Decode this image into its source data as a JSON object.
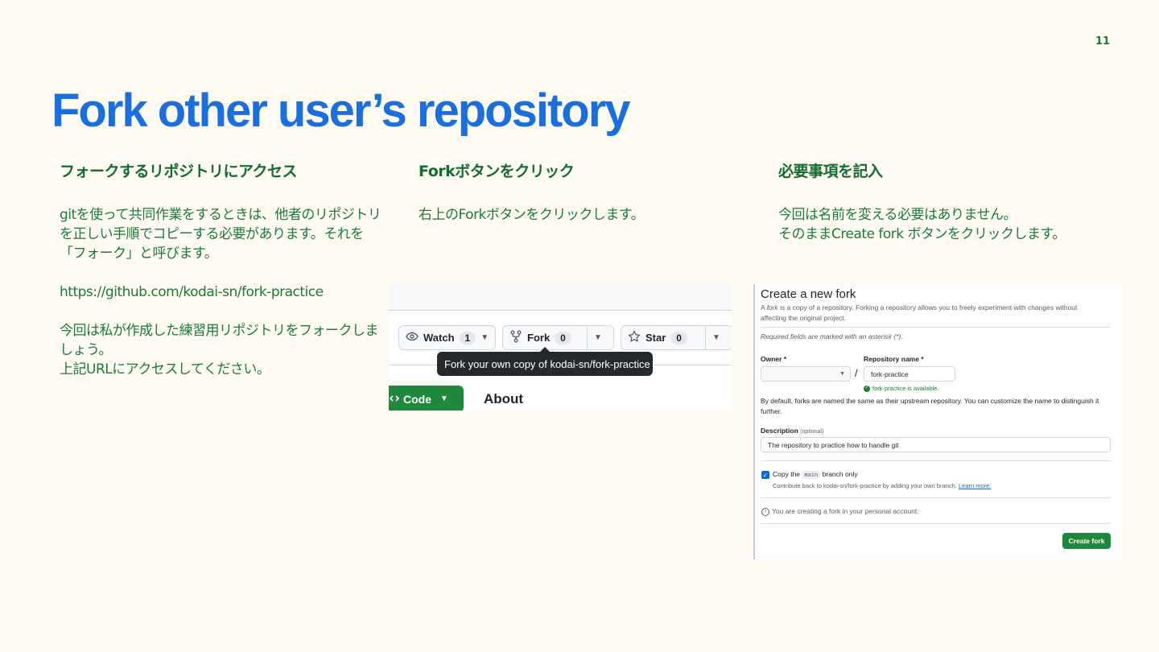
{
  "page_number": "11",
  "title": "Fork other user’s repository",
  "columns": [
    {
      "heading": "フォークするリポジトリにアクセス",
      "paragraphs": [
        "gitを使って共同作業をするときは、他者のリポジトリを正しい手順でコピーする必要があります。それを「フォーク」と呼びます。",
        "https://github.com/kodai-sn/fork-practice",
        "今回は私が作成した練習用リポジトリをフォークしましょう。",
        "上記URLにアクセスしてください。"
      ]
    },
    {
      "heading": "Forkボタンをクリック",
      "paragraphs": [
        "右上のForkボタンをクリックします。"
      ]
    },
    {
      "heading": "必要事項を記入",
      "paragraphs": [
        "今回は名前を変える必要はありません。",
        "そのままCreate fork ボタンをクリックします。"
      ]
    }
  ],
  "github_toolbar": {
    "watch_label": "Watch",
    "watch_count": "1",
    "fork_label": "Fork",
    "fork_count": "0",
    "star_label": "Star",
    "star_count": "0",
    "tooltip": "Fork your own copy of kodai-sn/fork-practice",
    "code_label": "Code",
    "about_label": "About"
  },
  "fork_form": {
    "heading": "Create a new fork",
    "intro_prefix": "A ",
    "intro_italic": "fork",
    "intro_rest": " is a copy of a repository. Forking a repository allows you to freely experiment with changes without affecting the original project.",
    "required_note": "Required fields are marked with an asterisk (*).",
    "owner_label": "Owner *",
    "owner_value": "",
    "repo_name_label": "Repository name *",
    "repo_name_value": "fork-practice",
    "availability": "fork-practice is available.",
    "slash": "/",
    "naming_note": "By default, forks are named the same as their upstream repository. You can customize the name to distinguish it further.",
    "description_label": "Description",
    "description_optional": "(optional)",
    "description_value": "The repository to practice how to handle git",
    "copy_prefix": "Copy the",
    "copy_branch": "main",
    "copy_suffix": "branch only",
    "copy_checked": true,
    "contribute_text": "Contribute back to kodai-sn/fork-practice by adding your own branch.",
    "learn_more": "Learn more.",
    "info_text": "You are creating a fork in your personal account.",
    "submit_label": "Create fork"
  },
  "colors": {
    "background": "#fffbf2",
    "title_blue": "#1a6fe0",
    "text_green": "#1a7a3a",
    "github_green": "#1f883d"
  }
}
